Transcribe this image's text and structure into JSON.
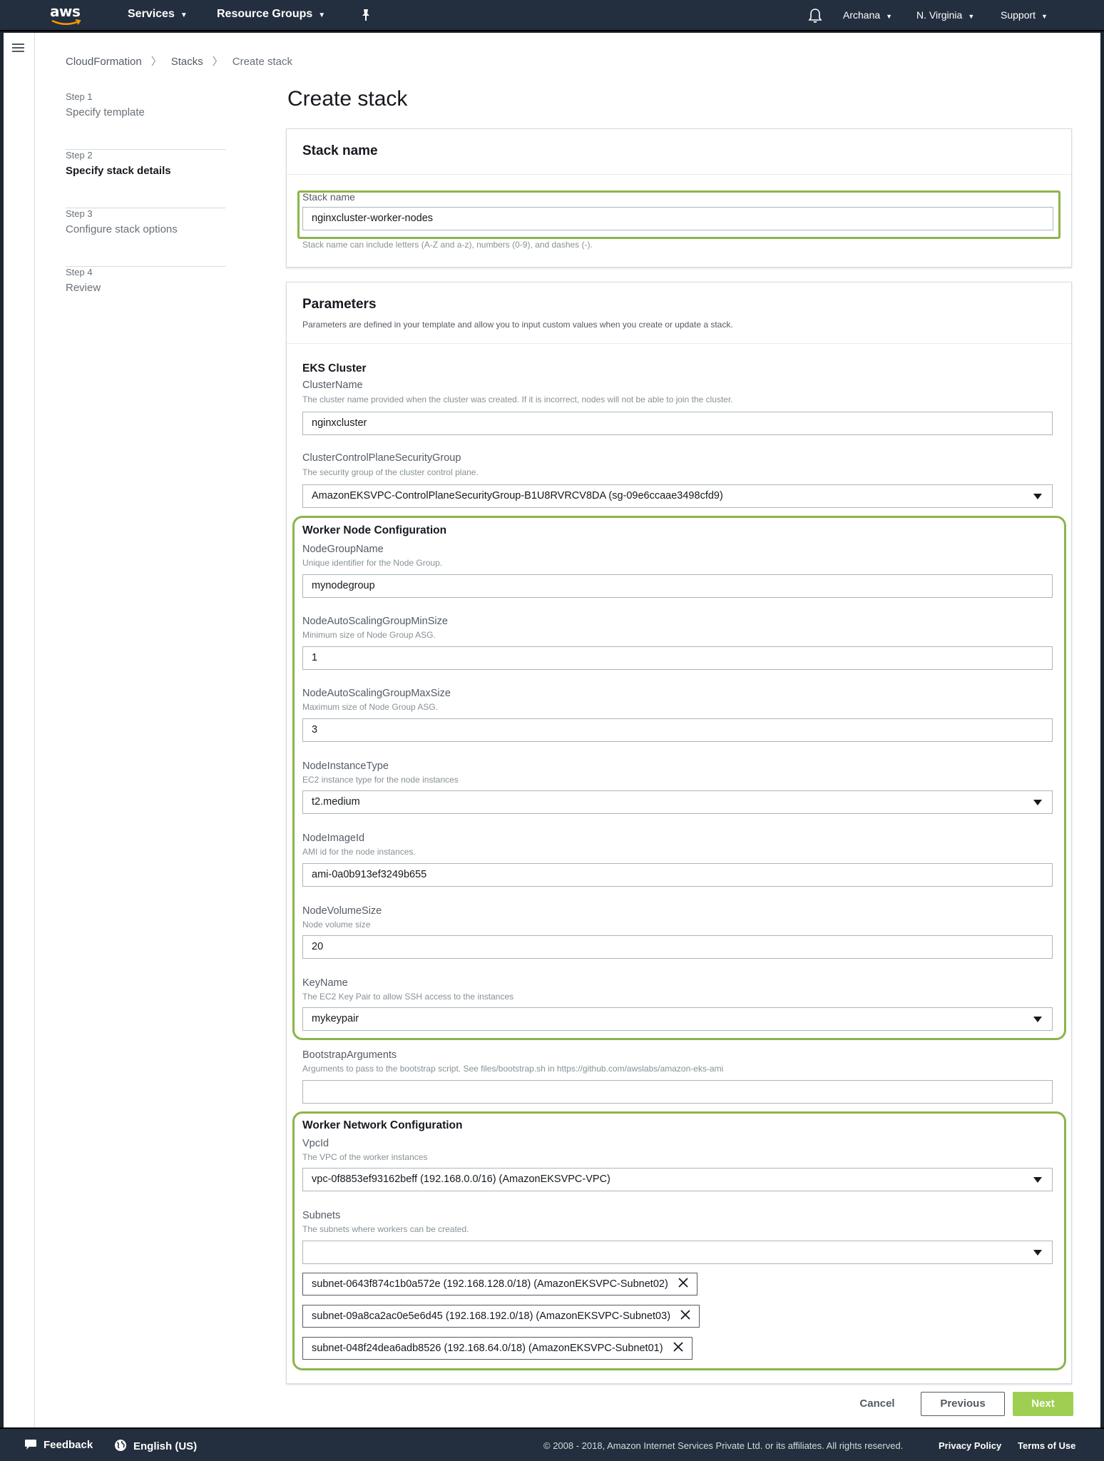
{
  "nav": {
    "logo": "aws",
    "services": "Services",
    "resource_groups": "Resource Groups",
    "user": "Archana",
    "region": "N. Virginia",
    "support": "Support"
  },
  "breadcrumb": [
    "CloudFormation",
    "Stacks",
    "Create stack"
  ],
  "steps": [
    {
      "num": "Step 1",
      "label": "Specify template"
    },
    {
      "num": "Step 2",
      "label": "Specify stack details"
    },
    {
      "num": "Step 3",
      "label": "Configure stack options"
    },
    {
      "num": "Step 4",
      "label": "Review"
    }
  ],
  "page_title": "Create stack",
  "stack_name_panel": {
    "title": "Stack name",
    "label": "Stack name",
    "value": "nginxcluster-worker-nodes",
    "hint": "Stack name can include letters (A-Z and a-z), numbers (0-9), and dashes (-)."
  },
  "parameters": {
    "title": "Parameters",
    "description": "Parameters are defined in your template and allow you to input custom values when you create or update a stack.",
    "eks_cluster": {
      "title": "EKS Cluster",
      "cluster_name": {
        "label": "ClusterName",
        "desc": "The cluster name provided when the cluster was created. If it is incorrect, nodes will not be able to join the cluster.",
        "value": "nginxcluster"
      },
      "control_plane_sg": {
        "label": "ClusterControlPlaneSecurityGroup",
        "desc": "The security group of the cluster control plane.",
        "value": "AmazonEKSVPC-ControlPlaneSecurityGroup-B1U8RVRCV8DA (sg-09e6ccaae3498cfd9)"
      }
    },
    "worker_node": {
      "title": "Worker Node Configuration",
      "node_group_name": {
        "label": "NodeGroupName",
        "desc": "Unique identifier for the Node Group.",
        "value": "mynodegroup"
      },
      "min_size": {
        "label": "NodeAutoScalingGroupMinSize",
        "desc": "Minimum size of Node Group ASG.",
        "value": "1"
      },
      "max_size": {
        "label": "NodeAutoScalingGroupMaxSize",
        "desc": "Maximum size of Node Group ASG.",
        "value": "3"
      },
      "instance_type": {
        "label": "NodeInstanceType",
        "desc": "EC2 instance type for the node instances",
        "value": "t2.medium"
      },
      "image_id": {
        "label": "NodeImageId",
        "desc": "AMI id for the node instances.",
        "value": "ami-0a0b913ef3249b655"
      },
      "volume_size": {
        "label": "NodeVolumeSize",
        "desc": "Node volume size",
        "value": "20"
      },
      "key_name": {
        "label": "KeyName",
        "desc": "The EC2 Key Pair to allow SSH access to the instances",
        "value": "mykeypair"
      }
    },
    "bootstrap": {
      "label": "BootstrapArguments",
      "desc": "Arguments to pass to the bootstrap script. See files/bootstrap.sh in https://github.com/awslabs/amazon-eks-ami",
      "value": ""
    },
    "worker_network": {
      "title": "Worker Network Configuration",
      "vpc": {
        "label": "VpcId",
        "desc": "The VPC of the worker instances",
        "value": "vpc-0f8853ef93162beff (192.168.0.0/16) (AmazonEKSVPC-VPC)"
      },
      "subnets": {
        "label": "Subnets",
        "desc": "The subnets where workers can be created.",
        "value": "",
        "tokens": [
          "subnet-0643f874c1b0a572e (192.168.128.0/18) (AmazonEKSVPC-Subnet02)",
          "subnet-09a8ca2ac0e5e6d45 (192.168.192.0/18) (AmazonEKSVPC-Subnet03)",
          "subnet-048f24dea6adb8526 (192.168.64.0/18) (AmazonEKSVPC-Subnet01)"
        ]
      }
    }
  },
  "actions": {
    "cancel": "Cancel",
    "previous": "Previous",
    "next": "Next"
  },
  "footer": {
    "feedback": "Feedback",
    "language": "English (US)",
    "copyright": "© 2008 - 2018, Amazon Internet Services Private Ltd. or its affiliates. All rights reserved.",
    "privacy": "Privacy Policy",
    "terms": "Terms of Use"
  },
  "icons": {
    "menu": "hamburger-icon",
    "pin": "pin-icon",
    "notifications": "bell-icon",
    "dropdown": "caret-down-icon",
    "remove": "close-icon",
    "feedback": "speech-bubble-icon",
    "language": "globe-icon"
  },
  "colors": {
    "nav_bg": "#232f3e",
    "highlight": "#8cb44a",
    "primary_button": "#9fcf52",
    "text": "#16191f",
    "muted_text": "#879196"
  }
}
